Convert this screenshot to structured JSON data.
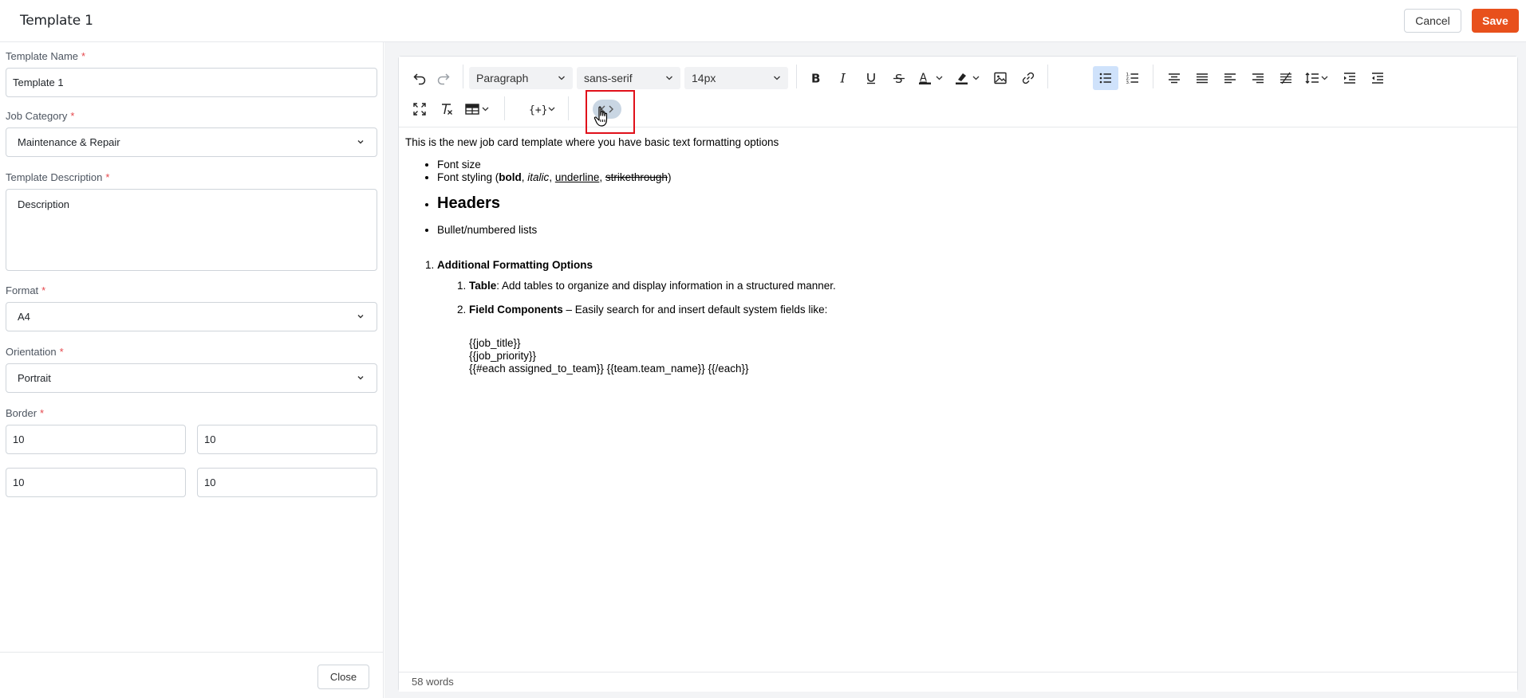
{
  "header": {
    "title": "Template 1",
    "cancel_label": "Cancel",
    "save_label": "Save",
    "save_color": "#e8501c"
  },
  "form": {
    "template_name": {
      "label": "Template Name",
      "value": "Template 1"
    },
    "job_category": {
      "label": "Job Category",
      "value": "Maintenance & Repair"
    },
    "template_description": {
      "label": "Template Description",
      "value": "Description"
    },
    "format": {
      "label": "Format",
      "value": "A4"
    },
    "orientation": {
      "label": "Orientation",
      "value": "Portrait"
    },
    "border": {
      "label": "Border",
      "values": [
        "10",
        "10",
        "10",
        "10"
      ]
    },
    "required_mark": "*",
    "close_label": "Close"
  },
  "toolbar": {
    "block_format": "Paragraph",
    "font_family": "sans-serif",
    "font_size": "14px",
    "icons": [
      "undo-icon",
      "redo-icon",
      "bold-icon",
      "italic-icon",
      "underline-icon",
      "strikethrough-icon",
      "text-color-icon",
      "highlight-color-icon",
      "image-icon",
      "link-icon",
      "bullet-list-icon",
      "numbered-list-icon",
      "align-center-icon",
      "justify-icon",
      "align-left-icon",
      "align-right-icon",
      "ltr-rtl-icon",
      "line-height-icon",
      "indent-icon",
      "outdent-icon",
      "fullscreen-icon",
      "clear-formatting-icon",
      "table-icon",
      "field-component-icon",
      "source-code-icon"
    ],
    "active_icon": "bullet-list-icon",
    "highlighted_icon": "source-code-icon",
    "highlight_color": "#e0101a"
  },
  "document": {
    "intro": "This is the new job card template where you have basic text formatting options",
    "bullet_font_size": "Font size",
    "bullet_font_styling_prefix": "Font styling (",
    "bold": "bold",
    "italic": "italic",
    "underline": "underline",
    "strikethrough": "strikethrough",
    "comma": ", ",
    "close_paren": ")",
    "headers": "Headers",
    "bullet_lists": "Bullet/numbered lists",
    "additional": "Additional Formatting Options",
    "table_label": "Table",
    "table_text": ": Add tables to organize and display information in a structured manner.",
    "field_label": "Field Components",
    "field_text": " – Easily search for and insert default system fields like:",
    "code_lines": [
      "{{job_title}}",
      "{{job_priority}}",
      "{{#each assigned_to_team}} {{team.team_name}} {{/each}}"
    ]
  },
  "status": {
    "word_count": "58 words"
  }
}
